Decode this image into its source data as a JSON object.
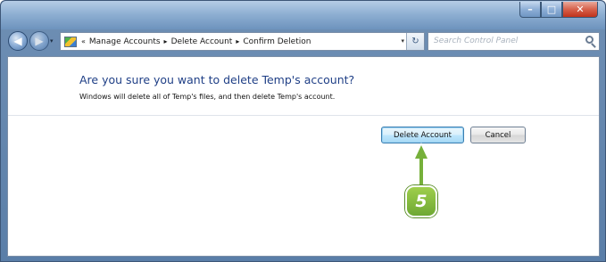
{
  "window_controls": {
    "minimize": "–",
    "maximize": "□",
    "close": "✕"
  },
  "navigation": {
    "back_icon": "arrow-left-icon",
    "forward_icon": "arrow-right-icon",
    "back_glyph": "◀",
    "forward_glyph": "▶",
    "history_glyph": "▾"
  },
  "breadcrumb": {
    "lead": "«",
    "items": [
      "Manage Accounts",
      "Delete Account",
      "Confirm Deletion"
    ],
    "separator": "▸"
  },
  "address": {
    "dropdown_glyph": "▾",
    "refresh_glyph": "↻"
  },
  "search": {
    "placeholder": "Search Control Panel"
  },
  "dialog": {
    "question": "Are you sure you want to delete Temp's account?",
    "subtext": "Windows will delete all of Temp's files, and then delete Temp's account.",
    "delete_button": "Delete Account",
    "cancel_button": "Cancel"
  },
  "callout": {
    "step": "5",
    "color": "#76b03a"
  }
}
